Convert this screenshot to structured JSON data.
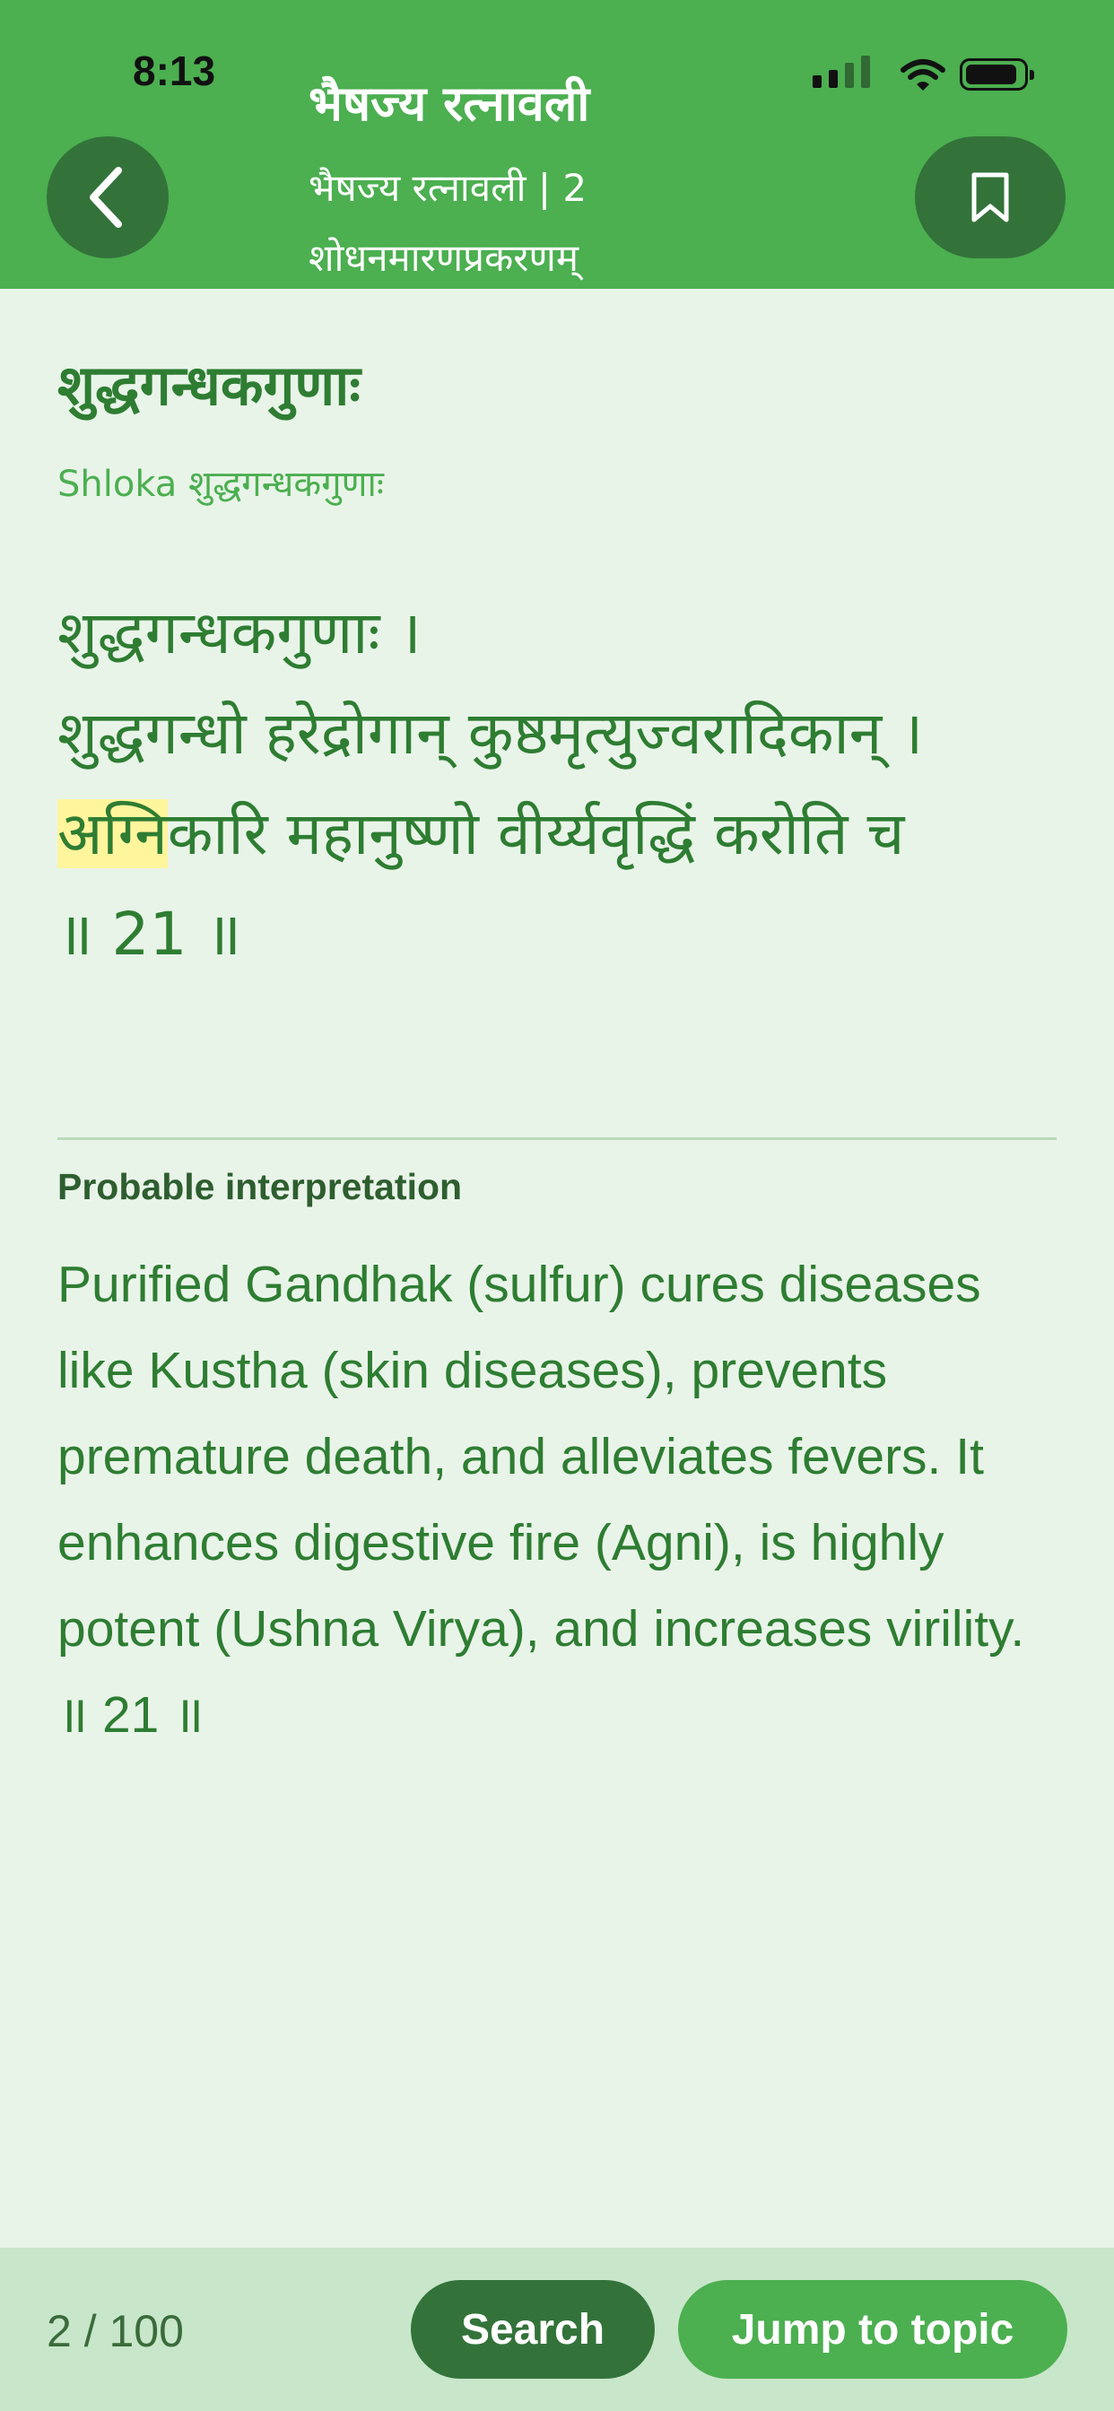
{
  "status_bar": {
    "time": "8:13"
  },
  "header": {
    "title": "भैषज्य रत्नावली",
    "subtitle_line1": "भैषज्य रत्नावली | 2",
    "subtitle_line2": "शोधनमारणप्रकरणम्",
    "back_icon": "chevron-left-icon",
    "bookmark_icon": "bookmark-icon"
  },
  "content": {
    "title": "शुद्धगन्धकगुणाः",
    "shloka_subtitle": "Shloka शुद्धगन्धकगुणाः",
    "verse": {
      "line1": "शुद्धगन्धकगुणाः ।",
      "line2": "शुद्धगन्धो हरेद्रोगान् कुष्ठमृत्युज्वरादिकान् ।",
      "line3_highlight": "अग्नि",
      "line3_rest": "कारि महानुष्णो वीर्य्यवृद्धिं करोति च",
      "line4": "॥ 21 ॥"
    },
    "interpretation_label": "Probable interpretation",
    "interpretation_text": "Purified Gandhak (sulfur) cures diseases like Kustha (skin diseases), prevents premature death, and alleviates fevers. It enhances digestive fire (Agni), is highly potent (Ushna Virya), and increases virility. ॥ 21 ॥"
  },
  "footer": {
    "page_count": "2 / 100",
    "search_label": "Search",
    "jump_label": "Jump to topic"
  },
  "colors": {
    "header_bg": "#4caf50",
    "button_dark": "#33733a",
    "page_bg": "#e9f4e9",
    "text_green": "#2e7d32",
    "footer_bg": "#c8e6c9",
    "highlight": "#fff59d"
  }
}
